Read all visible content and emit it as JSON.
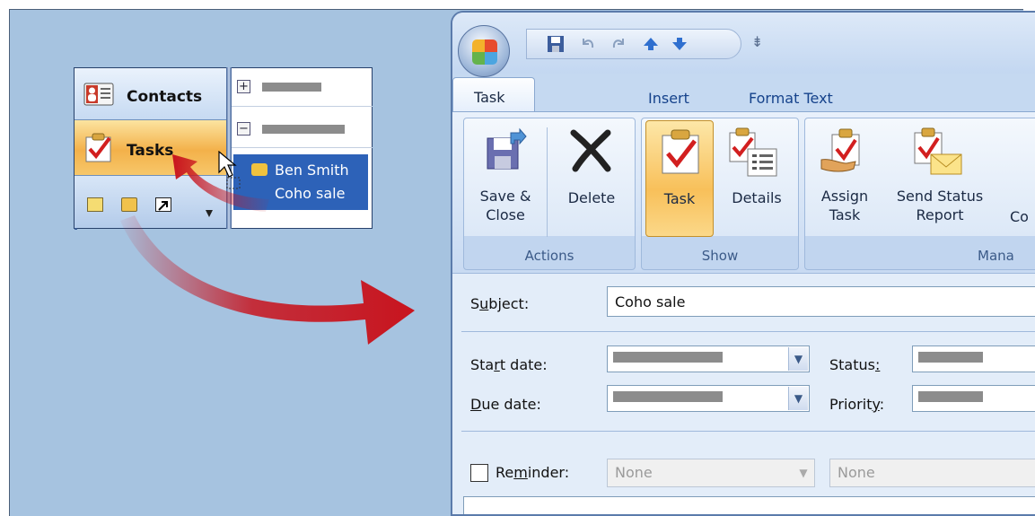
{
  "nav": {
    "contacts_label": "Contacts",
    "tasks_label": "Tasks"
  },
  "task_list": {
    "selected_name": "Ben Smith",
    "selected_subject": "Coho sale",
    "expand_symbol": "+",
    "collapse_symbol": "−"
  },
  "window": {
    "qat_customize": "⇟",
    "tabs": [
      "Task",
      "Insert",
      "Format Text"
    ],
    "active_tab": "Task",
    "ribbon": {
      "actions_group": "Actions",
      "show_group": "Show",
      "manage_group": "Mana",
      "save_close_l1": "Save &",
      "save_close_l2": "Close",
      "delete": "Delete",
      "task": "Task",
      "details": "Details",
      "assign_l1": "Assign",
      "assign_l2": "Task",
      "send_status_l1": "Send Status",
      "send_status_l2": "Report",
      "cut_off": "Co"
    }
  },
  "form": {
    "subject_label": "Subject:",
    "subject_value": "Coho sale",
    "start_date_label": "Start date:",
    "due_date_label": "Due date:",
    "status_label": "Status:",
    "priority_label": "Priority:",
    "reminder_label": "Reminder:",
    "reminder_date": "None",
    "reminder_time": "None"
  },
  "colors": {
    "background": "#a6c3e0",
    "accent_orange": "#f3b14a",
    "selection_blue": "#2d62b8",
    "arrow_red": "#c8141e"
  }
}
